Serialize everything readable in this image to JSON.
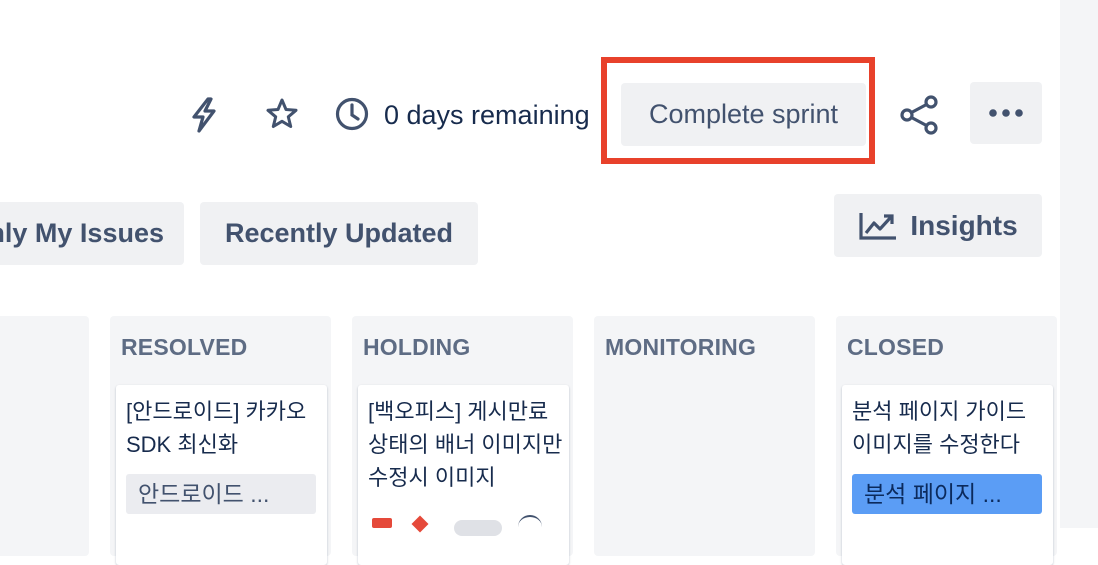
{
  "header": {
    "remaining_text": "0 days remaining",
    "complete_sprint_label": "Complete sprint",
    "icons": {
      "automation": "lightning-bolt-icon",
      "star": "star-icon",
      "clock": "clock-icon",
      "share": "share-icon",
      "more": "more-horizontal-icon"
    }
  },
  "filters": {
    "only_my_issues": "nly My Issues",
    "recently_updated": "Recently Updated",
    "insights": "Insights"
  },
  "columns": [
    {
      "title": ""
    },
    {
      "title": "RESOLVED",
      "card": {
        "title": "[안드로이드] 카카오 SDK 최신화",
        "epic": "안드로이드 ..."
      }
    },
    {
      "title": "HOLDING",
      "card": {
        "title": "[백오피스] 게시만료 상태의 배너 이미지만 수정시 이미지"
      }
    },
    {
      "title": "MONITORING"
    },
    {
      "title": "CLOSED",
      "card": {
        "title": "분석 페이지 가이드 이미지를 수정한다",
        "epic": "분석 페이지 ..."
      }
    }
  ],
  "colors": {
    "highlight": "#e8412b",
    "epic_blue": "#5b9df5",
    "epic_grey": "#ebecf0"
  }
}
